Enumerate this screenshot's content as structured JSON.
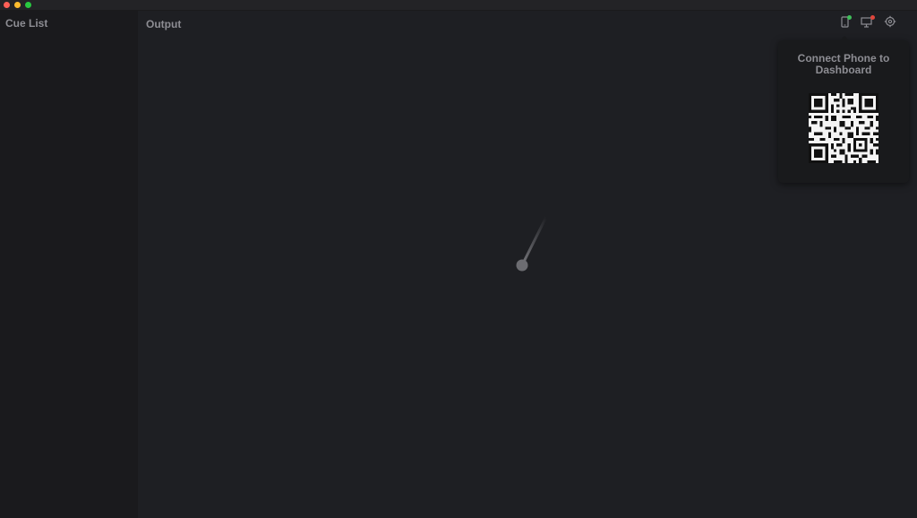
{
  "window": {
    "controls": [
      "close",
      "minimize",
      "zoom"
    ]
  },
  "sidebar": {
    "title": "Cue List"
  },
  "main": {
    "title": "Output"
  },
  "toolbar": {
    "icons": [
      {
        "name": "phone-connection-icon",
        "status_color": "#3fbf5a"
      },
      {
        "name": "display-connection-icon",
        "status_color": "#e0463c"
      },
      {
        "name": "settings-icon"
      }
    ]
  },
  "qr_popover": {
    "title": "Connect Phone to Dashboard"
  },
  "colors": {
    "background": "#1e1f23",
    "sidebar": "#1a1a1d",
    "text": "#8d8d93",
    "connected": "#3fbf5a",
    "disconnected": "#e0463c"
  }
}
